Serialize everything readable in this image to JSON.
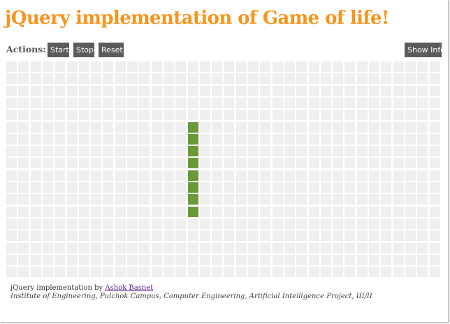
{
  "page": {
    "title": "jQuery implementation of Game of life!"
  },
  "actions": {
    "label": "Actions:",
    "start_label": "Start",
    "stop_label": "Stop",
    "reset_label": "Reset",
    "info_label": "Show Info"
  },
  "grid": {
    "columns": 36,
    "rows": 18,
    "live_cells": [
      {
        "row": 5,
        "col": 15
      },
      {
        "row": 6,
        "col": 15
      },
      {
        "row": 7,
        "col": 15
      },
      {
        "row": 8,
        "col": 15
      },
      {
        "row": 9,
        "col": 15
      },
      {
        "row": 10,
        "col": 15
      },
      {
        "row": 11,
        "col": 15
      },
      {
        "row": 12,
        "col": 15
      }
    ]
  },
  "footer": {
    "credit_prefix": "jQuery implementation by ",
    "author": "Ashok Basnet",
    "affiliation": "Institute of Engineering, Pulchok Campus, Computer Engineering, Artificial Intelligence Project, III/II"
  },
  "colors": {
    "title": "#f7941e",
    "button_bg": "#5b5b5b",
    "cell_dead": "#efefef",
    "cell_live": "#6a9a38",
    "link": "#551a8b"
  }
}
